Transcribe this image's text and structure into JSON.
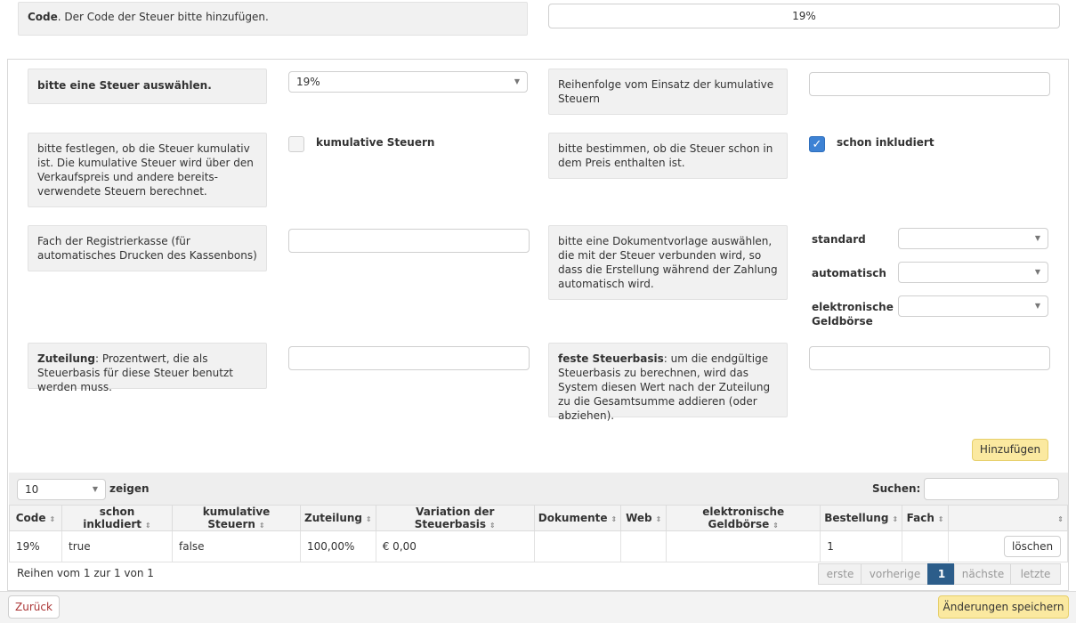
{
  "code_row": {
    "label_bold": "Code",
    "label_text": ". Der Code der Steuer bitte hinzufügen.",
    "value": "19%"
  },
  "tax_select": {
    "label": "bitte eine Steuer auswählen.",
    "value": "19%"
  },
  "order": {
    "label": "Reihenfolge vom Einsatz der kumulative Steuern"
  },
  "cumulative": {
    "description": "bitte festlegen, ob die Steuer kumulativ ist. Die kumulative Steuer wird über den Verkaufspreis und andere bereits-verwendete Steuern berechnet.",
    "checkbox_label": "kumulative Steuern",
    "checked": false
  },
  "included": {
    "description": "bitte bestimmen, ob die Steuer schon in dem Preis enthalten ist.",
    "checkbox_label": "schon inkludiert",
    "checked": true
  },
  "register": {
    "label": "Fach der Registrierkasse (für automatisches Drucken des Kassenbons)"
  },
  "document": {
    "label": "bitte eine Dokumentvorlage auswählen, die mit der Steuer verbunden wird, so dass die Erstellung während der Zahlung automatisch wird.",
    "options": [
      {
        "label": "standard"
      },
      {
        "label": "automatisch"
      },
      {
        "label": "elektronische Geldbörse"
      }
    ]
  },
  "allocation": {
    "label_bold": "Zuteilung",
    "label_text": ": Prozentwert, die als Steuerbasis für diese Steuer benutzt werden muss."
  },
  "fixed_base": {
    "label_bold": "feste Steuerbasis",
    "label_text": ": um die endgültige Steuerbasis zu berechnen, wird das System diesen Wert nach der Zuteilung zu die Gesamtsumme addieren (oder abziehen)."
  },
  "add_button": "Hinzufügen",
  "table_controls": {
    "page_size": "10",
    "show_label": "zeigen",
    "search_label": "Suchen:"
  },
  "table": {
    "headers": [
      "Code",
      "schon inkludiert",
      "kumulative Steuern",
      "Zuteilung",
      "Variation der Steuerbasis",
      "Dokumente",
      "Web",
      "elektronische Geldbörse",
      "Bestellung",
      "Fach",
      ""
    ],
    "rows": [
      {
        "cells": [
          "19%",
          "true",
          "false",
          "100,00%",
          "€ 0,00",
          "",
          "",
          "",
          "1",
          ""
        ],
        "action": "löschen"
      }
    ]
  },
  "footer": {
    "info": "Reihen vom 1 zur 1 von 1",
    "pager": [
      "erste",
      "vorherige",
      "1",
      "nächste",
      "letzte"
    ]
  },
  "bottom": {
    "back": "Zurück",
    "save": "Änderungen speichern"
  },
  "colors": {
    "accent": "#3d82d4",
    "button_yellow": "#fbe9a0",
    "page_active": "#2c5d8a"
  }
}
